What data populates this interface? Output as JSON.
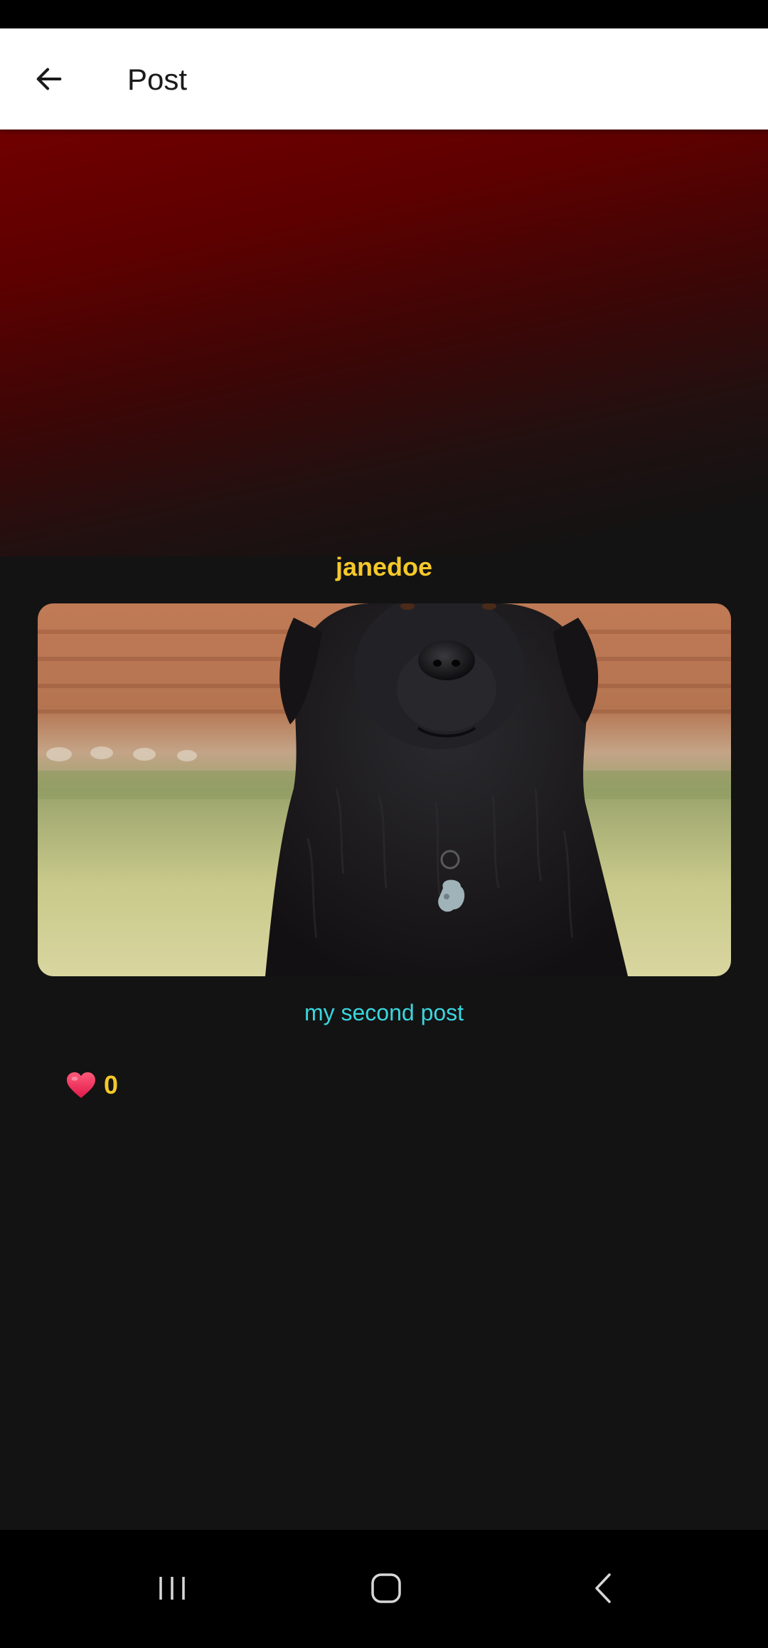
{
  "app_bar": {
    "title": "Post",
    "back_icon": "arrow-left-icon"
  },
  "post": {
    "username": "janedoe",
    "image_alt": "black-newfoundland-dog-photo",
    "caption": "my second post",
    "likes": {
      "icon": "heart-icon",
      "count": "0"
    }
  },
  "nav_bar": {
    "recents_icon": "recents-icon",
    "home_icon": "home-icon",
    "back_icon": "back-chevron-icon"
  },
  "colors": {
    "username": "#f5c82a",
    "caption": "#3ad6de",
    "like_count": "#f5c82a",
    "background": "#131313",
    "hero_gradient_top": "#700000"
  }
}
